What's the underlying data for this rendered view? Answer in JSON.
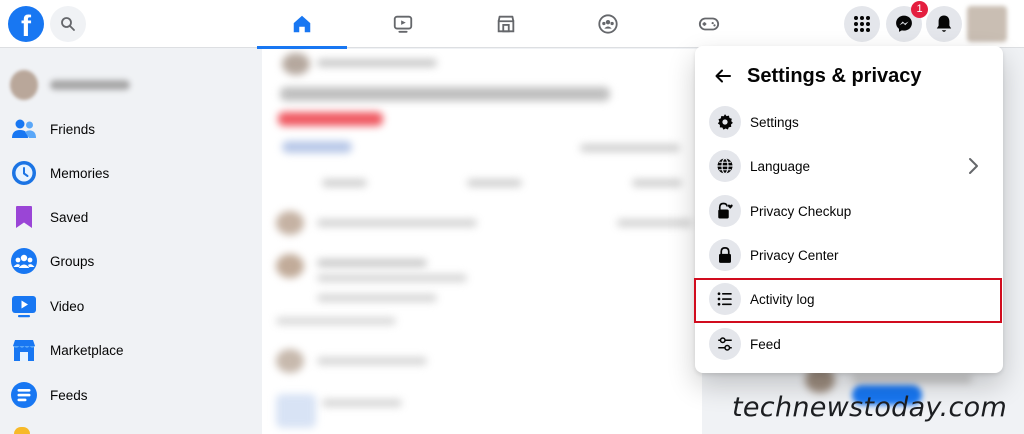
{
  "topbar": {
    "logo_letter": "f",
    "notifications_badge": "1"
  },
  "sidebar": {
    "items": [
      {
        "label": "Friends",
        "icon": "friends-icon"
      },
      {
        "label": "Memories",
        "icon": "memories-icon"
      },
      {
        "label": "Saved",
        "icon": "saved-icon"
      },
      {
        "label": "Groups",
        "icon": "groups-icon"
      },
      {
        "label": "Video",
        "icon": "video-icon"
      },
      {
        "label": "Marketplace",
        "icon": "marketplace-icon"
      },
      {
        "label": "Feeds",
        "icon": "feeds-icon"
      }
    ]
  },
  "dropdown": {
    "title": "Settings & privacy",
    "items": [
      {
        "label": "Settings",
        "icon": "gear-icon"
      },
      {
        "label": "Language",
        "icon": "globe-icon"
      },
      {
        "label": "Privacy Checkup",
        "icon": "lock-heart-icon"
      },
      {
        "label": "Privacy Center",
        "icon": "lock-icon"
      },
      {
        "label": "Activity log",
        "icon": "list-icon"
      },
      {
        "label": "Feed",
        "icon": "sliders-icon"
      }
    ]
  },
  "watermark": "technewstoday.com",
  "colors": {
    "brand": "#1877f2",
    "highlight": "#d10c1e",
    "badge": "#e41e3f"
  }
}
